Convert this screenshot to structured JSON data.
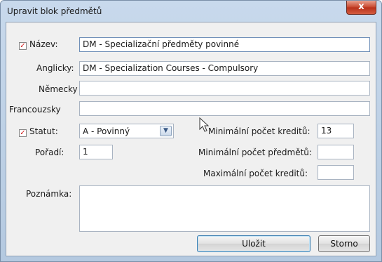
{
  "window": {
    "title": "Upravit blok předmětů",
    "close_label": "x"
  },
  "form": {
    "nazev": {
      "label": "Název:",
      "value": "DM - Specializační předměty povinné",
      "required": true
    },
    "anglicky": {
      "label": "Anglicky:",
      "value": "DM - Specialization Courses - Compulsory"
    },
    "nemecky": {
      "label": "Německy",
      "value": ""
    },
    "francouzsky": {
      "label": "Francouzsky",
      "value": ""
    },
    "statut": {
      "label": "Statut:",
      "value": "A - Povinný",
      "required": true
    },
    "poradi": {
      "label": "Pořadí:",
      "value": "1"
    },
    "min_kredity": {
      "label": "Minimální počet kreditů:",
      "value": "13"
    },
    "min_predmety": {
      "label": "Minimální počet předmětů:",
      "value": ""
    },
    "max_kredity": {
      "label": "Maximální počet kreditů:",
      "value": ""
    },
    "poznamka": {
      "label": "Poznámka:",
      "value": ""
    }
  },
  "buttons": {
    "save": "Uložit",
    "cancel": "Storno"
  },
  "icons": {
    "required": "checkbox-checked-icon",
    "dropdown": "chevron-down-icon",
    "close": "close-icon",
    "cursor": "mouse-pointer-icon"
  },
  "colors": {
    "required_mark": "#d21c1c",
    "close_button": "#c7452c",
    "title_bar": "#c8d9ec"
  }
}
